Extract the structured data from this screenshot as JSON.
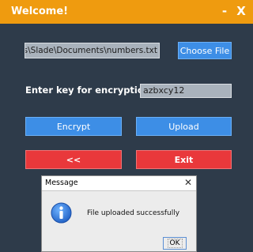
{
  "window": {
    "title": "Welcome!",
    "minimize_label": "-",
    "close_label": "X"
  },
  "file": {
    "path_value": "sers\\Slade\\Documents\\numbers.txt",
    "choose_label": "Choose File"
  },
  "encryption": {
    "key_label": "Enter key for encryption :",
    "key_value": "azbxcy12"
  },
  "actions": {
    "encrypt_label": "Encrypt",
    "upload_label": "Upload",
    "back_label": "<<",
    "exit_label": "Exit"
  },
  "dialog": {
    "title": "Message",
    "close_label": "✕",
    "message": "File uploaded successfully",
    "ok_label": "OK",
    "icon": "info-icon"
  },
  "colors": {
    "background": "#2e3b4a",
    "titlebar": "#ef9b0f",
    "primary_button": "#3d8ee6",
    "danger_button": "#e9383b"
  }
}
